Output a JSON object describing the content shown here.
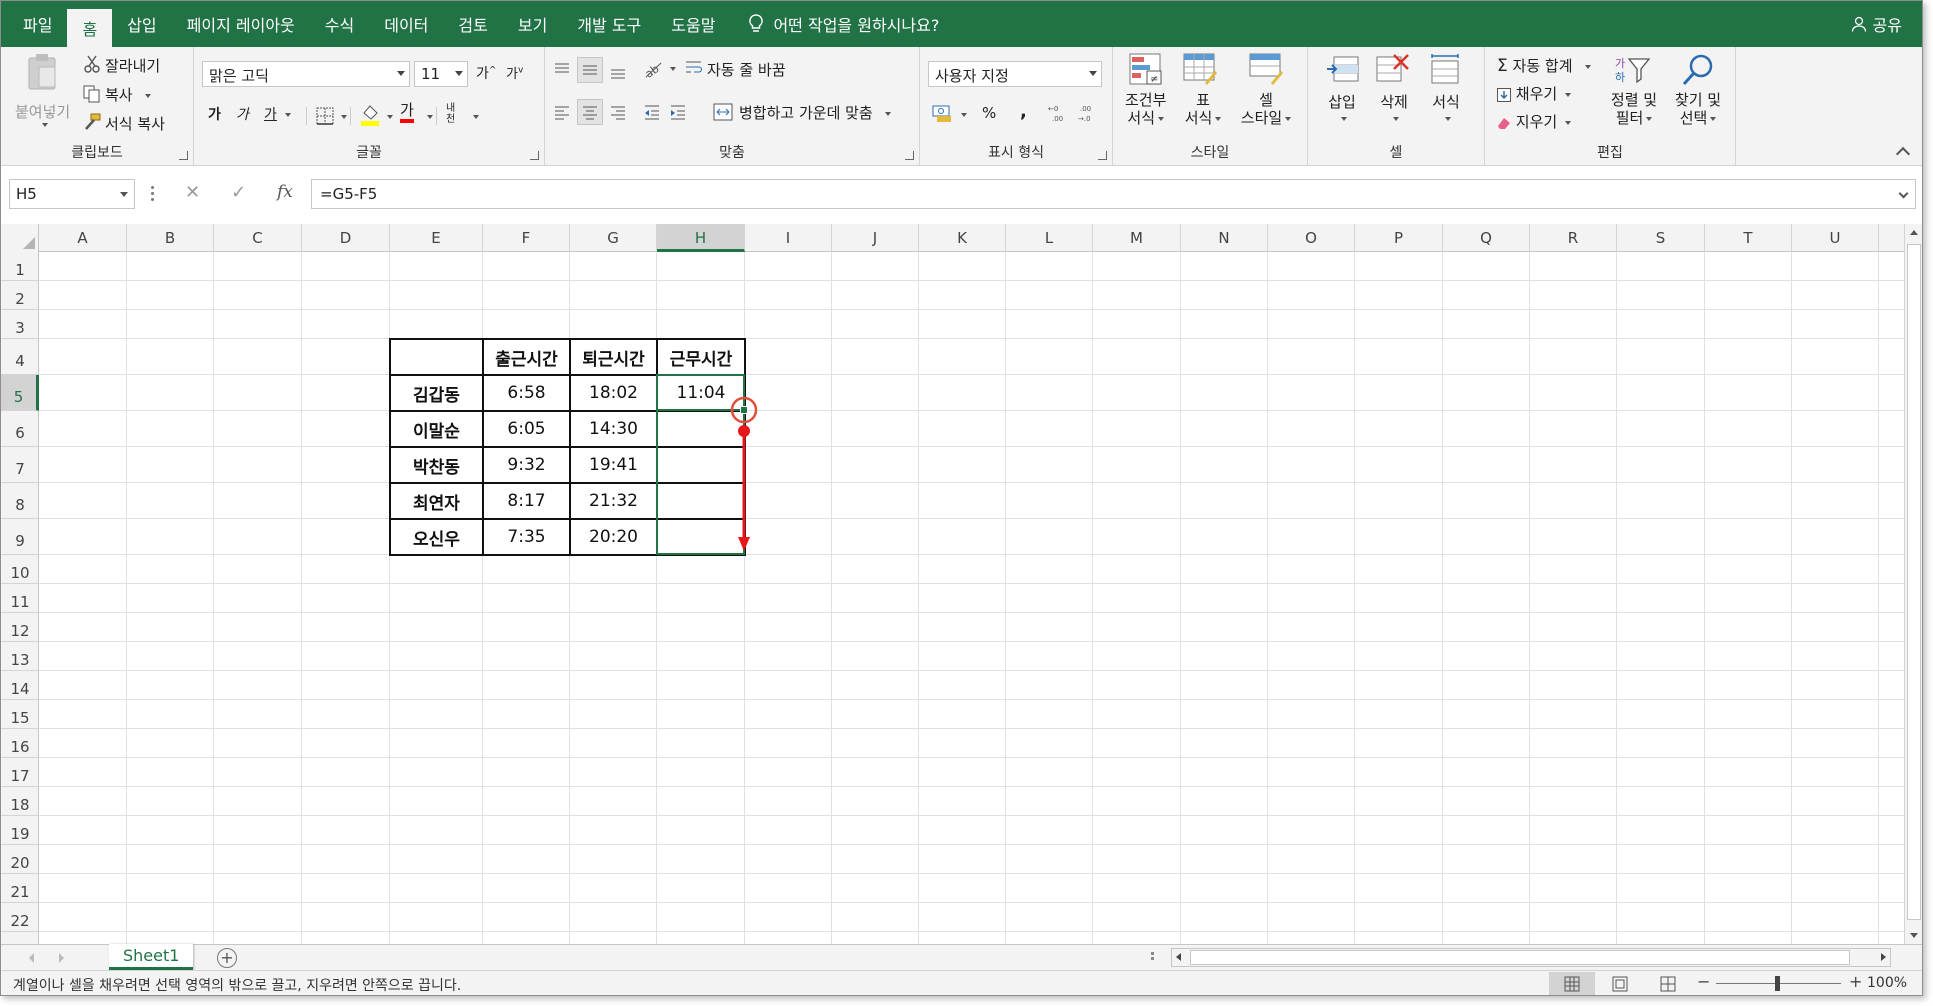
{
  "ribbon_tabs": [
    "파일",
    "홈",
    "삽입",
    "페이지 레이아웃",
    "수식",
    "데이터",
    "검토",
    "보기",
    "개발 도구",
    "도움말"
  ],
  "active_tab": "홈",
  "tell_me": "어떤 작업을 원하시나요?",
  "share": "공유",
  "ribbon": {
    "clipboard": {
      "paste": "붙여넣기",
      "cut": "잘라내기",
      "copy": "복사",
      "format_painter": "서식 복사",
      "label": "클립보드"
    },
    "font": {
      "font_name": "맑은 고딕",
      "font_size": "11",
      "grow": "가",
      "shrink": "가",
      "bold": "가",
      "italic": "가",
      "underline": "가",
      "color_letter": "가",
      "phonetic": "내천",
      "label": "글꼴"
    },
    "alignment": {
      "wrap_text": "자동 줄 바꿈",
      "merge_center": "병합하고 가운데 맞춤",
      "label": "맞춤"
    },
    "number": {
      "format": "사용자 지정",
      "percent": "%",
      "comma": ",",
      "label": "표시 형식"
    },
    "styles": {
      "conditional": [
        "조건부",
        "서식"
      ],
      "table": [
        "표",
        "서식"
      ],
      "cell": [
        "셀",
        "스타일"
      ],
      "label": "스타일"
    },
    "cells": {
      "insert": "삽입",
      "delete": "삭제",
      "format": "서식",
      "label": "셀"
    },
    "editing": {
      "autosum": "자동 합계",
      "fill": "채우기",
      "clear": "지우기",
      "sort_filter": [
        "정렬 및",
        "필터"
      ],
      "find_select": [
        "찾기 및",
        "선택"
      ],
      "label": "편집"
    }
  },
  "formula_bar": {
    "name_box": "H5",
    "cancel": "✕",
    "enter": "✓",
    "fx": "fx",
    "formula": "=G5-F5"
  },
  "columns": [
    "A",
    "B",
    "C",
    "D",
    "E",
    "F",
    "G",
    "H",
    "I",
    "J",
    "K",
    "L",
    "M",
    "N",
    "O",
    "P",
    "Q",
    "R",
    "S",
    "T",
    "U"
  ],
  "selected_column": "H",
  "rows": [
    "1",
    "2",
    "3",
    "4",
    "5",
    "6",
    "7",
    "8",
    "9",
    "10",
    "11",
    "12",
    "13",
    "14",
    "15",
    "16",
    "17",
    "18",
    "19",
    "20",
    "21",
    "22"
  ],
  "selected_row": "5",
  "table": {
    "headers": [
      "",
      "출근시간",
      "퇴근시간",
      "근무시간"
    ],
    "rows": [
      [
        "김갑동",
        "6:58",
        "18:02",
        "11:04"
      ],
      [
        "이말순",
        "6:05",
        "14:30",
        ""
      ],
      [
        "박찬동",
        "9:32",
        "19:41",
        ""
      ],
      [
        "최연자",
        "8:17",
        "21:32",
        ""
      ],
      [
        "오신우",
        "7:35",
        "20:20",
        ""
      ]
    ]
  },
  "sheet_tab": "Sheet1",
  "add_sheet": "+",
  "status_message": "계열이나 셀을 채우려면 선택 영역의 밖으로 끌고, 지우려면 안쪽으로 끕니다.",
  "zoom": {
    "minus": "−",
    "plus": "+",
    "level": "100%"
  },
  "colors": {
    "brand_green": "#217346",
    "annotation_red": "#e8161b"
  }
}
